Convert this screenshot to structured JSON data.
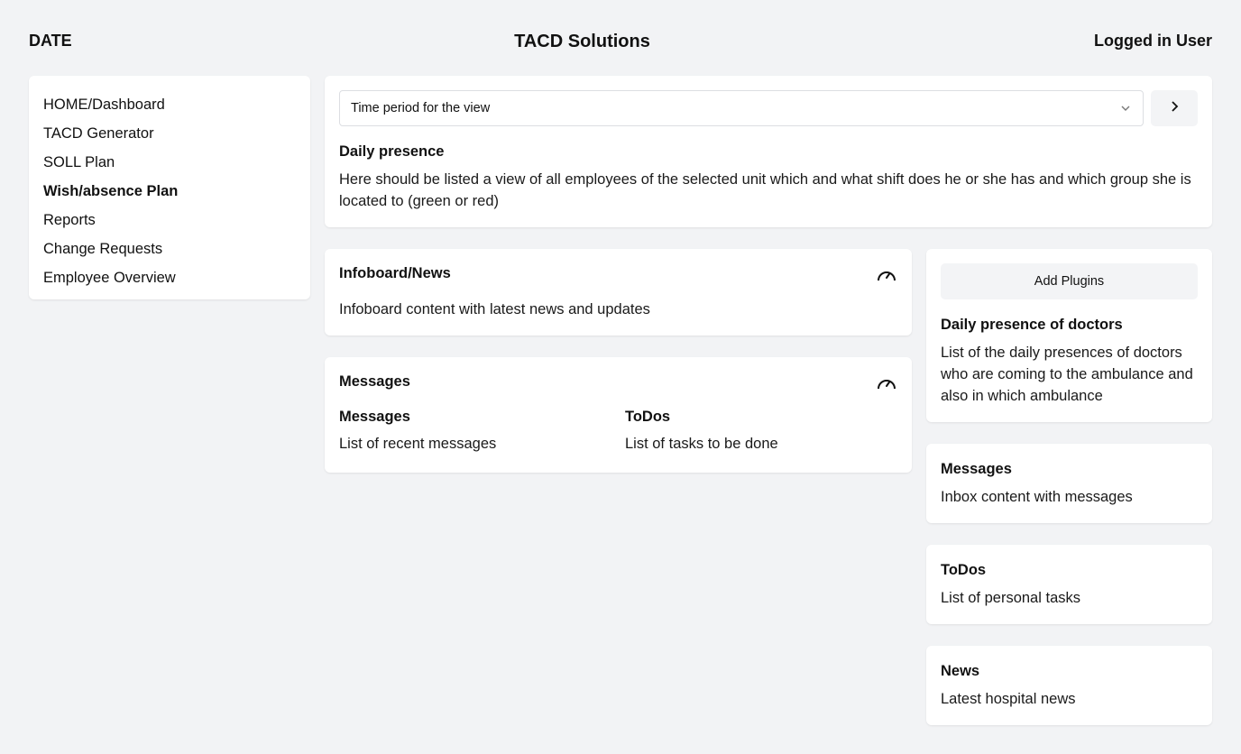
{
  "header": {
    "date_label": "DATE",
    "app_title": "TACD Solutions",
    "user_label": "Logged in User"
  },
  "sidebar": {
    "items": [
      {
        "label": "HOME/Dashboard"
      },
      {
        "label": "TACD Generator"
      },
      {
        "label": "SOLL Plan"
      },
      {
        "label": "Wish/absence Plan"
      },
      {
        "label": "Reports"
      },
      {
        "label": "Change Requests"
      },
      {
        "label": "Employee Overview"
      }
    ],
    "active_index": 3
  },
  "time_period": {
    "placeholder": "Time period for the view"
  },
  "daily_presence": {
    "title": "Daily presence",
    "text": "Here should be listed a view of all employees of the selected unit which and what shift does he or she has and which group she is located to (green or red)"
  },
  "infoboard": {
    "title": "Infoboard/News",
    "text": "Infoboard content with latest news and updates"
  },
  "messages_panel": {
    "title": "Messages",
    "messages_heading": "Messages",
    "messages_text": "List of recent messages",
    "todos_heading": "ToDos",
    "todos_text": "List of tasks to be done"
  },
  "plugins": {
    "add_label": "Add Plugins",
    "doctors_title": "Daily presence of doctors",
    "doctors_text": "List of the daily presences of doctors who are coming to the ambulance and also in which ambulance"
  },
  "side_messages": {
    "title": "Messages",
    "text": "Inbox content with messages"
  },
  "side_todos": {
    "title": "ToDos",
    "text": "List of personal tasks"
  },
  "side_news": {
    "title": "News",
    "text": "Latest hospital news"
  },
  "icons": {
    "dropdown": "chevron-down-icon",
    "next": "chevron-right-icon",
    "gauge": "gauge-icon"
  }
}
